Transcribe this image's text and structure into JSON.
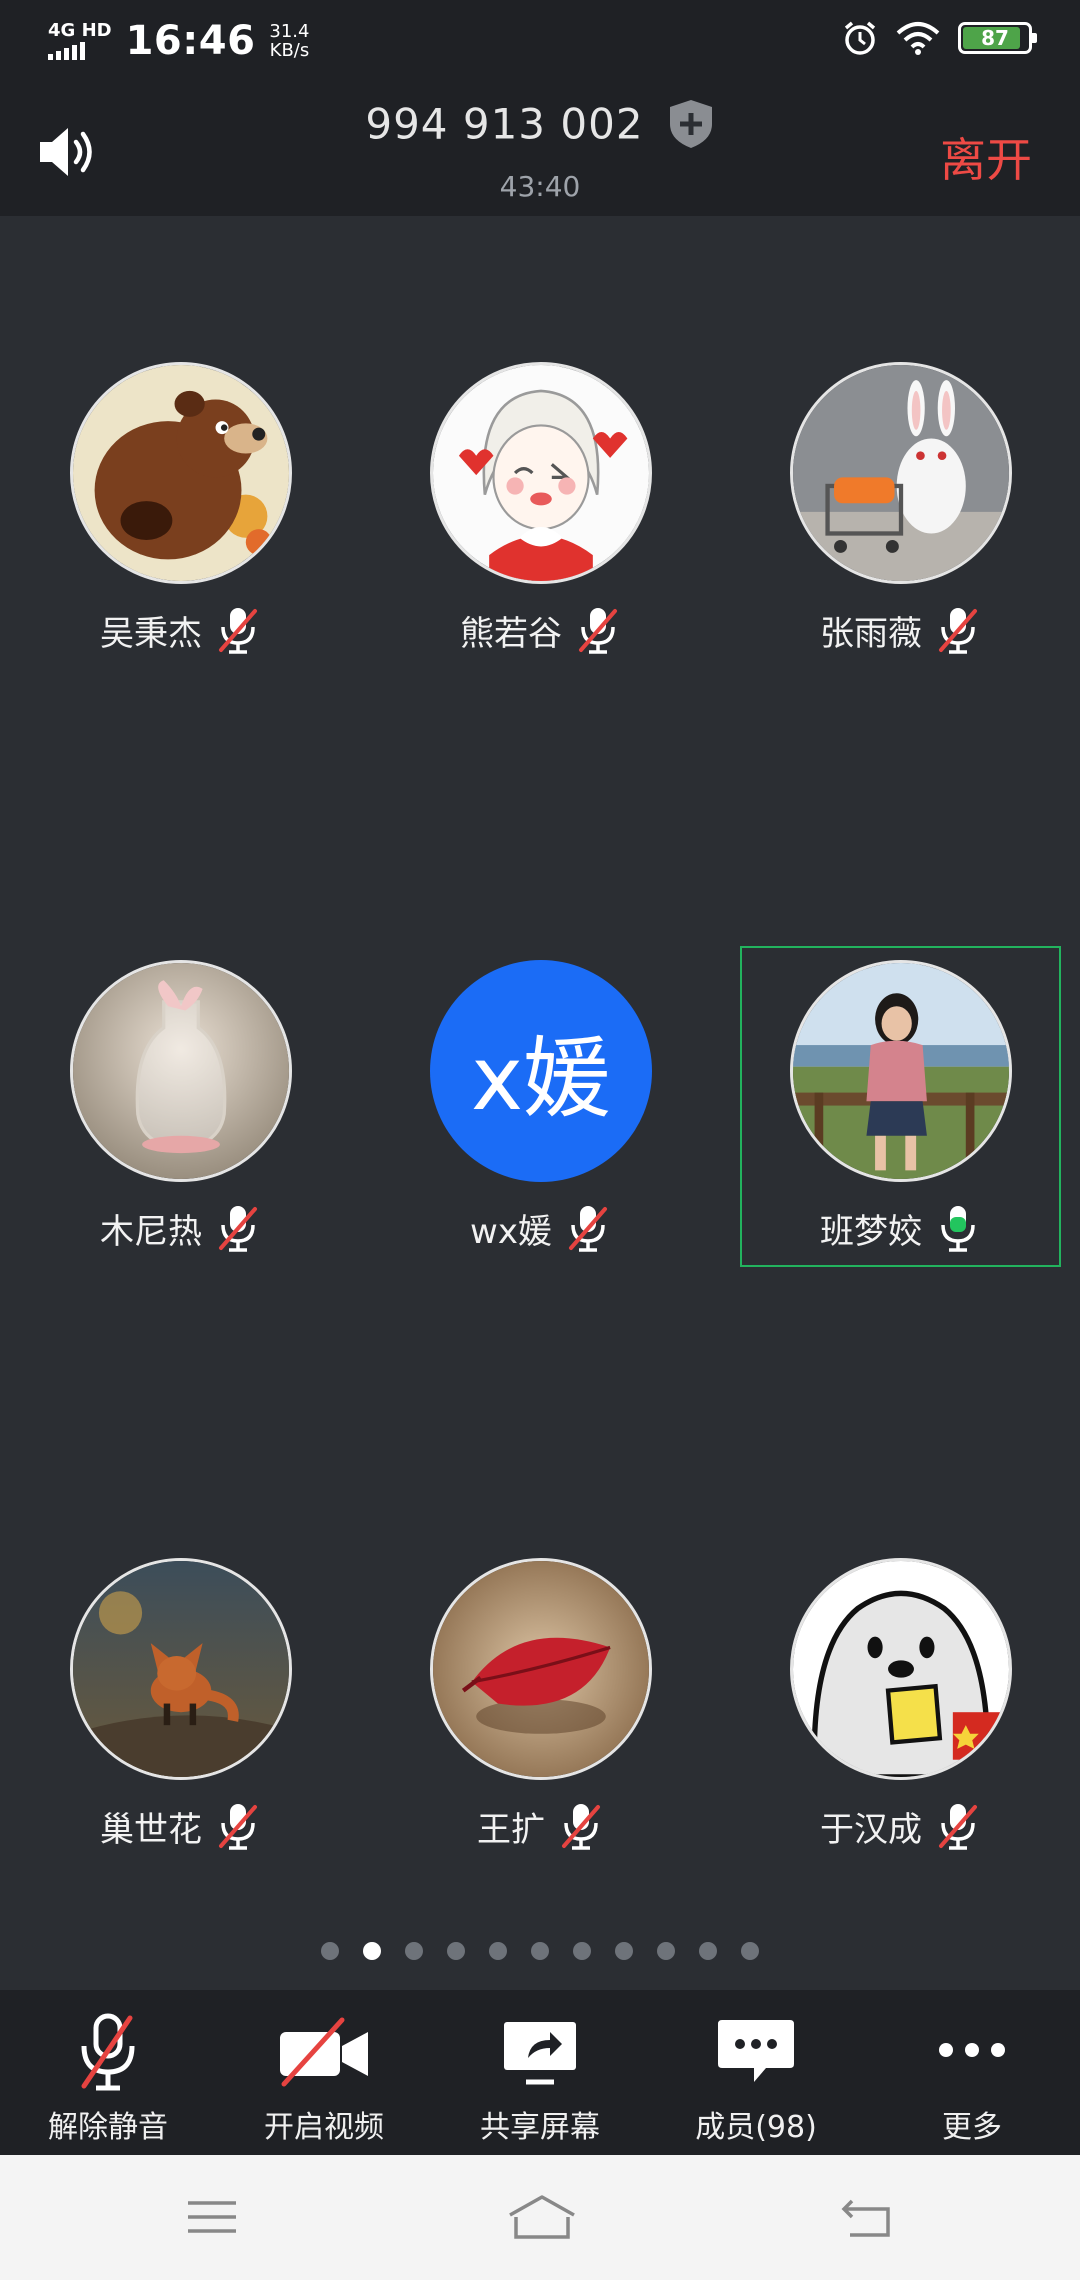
{
  "status_bar": {
    "network": "4G HD",
    "time": "16:46",
    "speed_value": "31.4",
    "speed_unit": "KB/s",
    "battery": "87"
  },
  "header": {
    "meeting_id": "994 913 002",
    "duration": "43:40",
    "leave_label": "离开"
  },
  "participants": [
    {
      "name": "吴秉杰",
      "avatar_icon": "bear-avatar-icon",
      "muted": true
    },
    {
      "name": "熊若谷",
      "avatar_icon": "girl-cartoon-avatar-icon",
      "muted": true
    },
    {
      "name": "张雨薇",
      "avatar_icon": "rabbit-avatar-icon",
      "muted": true
    },
    {
      "name": "木尼热",
      "avatar_icon": "bottle-avatar-icon",
      "muted": true
    },
    {
      "name": "wx媛",
      "avatar_text": "x媛",
      "muted": true
    },
    {
      "name": "班梦姣",
      "avatar_icon": "photo-avatar-icon",
      "muted": false,
      "speaking": true
    },
    {
      "name": "巢世花",
      "avatar_icon": "fox-avatar-icon",
      "muted": true
    },
    {
      "name": "王扩",
      "avatar_icon": "leaf-avatar-icon",
      "muted": true
    },
    {
      "name": "于汉成",
      "avatar_icon": "duck-meme-avatar-icon",
      "muted": true
    }
  ],
  "pager": {
    "total": 11,
    "current": 2
  },
  "toolbar": {
    "unmute": "解除静音",
    "start_video": "开启视频",
    "share_screen": "共享屏幕",
    "members": "成员(98)",
    "more": "更多"
  },
  "colors": {
    "background": "#2b2e33",
    "bar": "#1f2125",
    "leave": "#ee4a45",
    "muted_slash": "#e64340",
    "speaking": "#22b35e",
    "text_avatar": "#1b6cf6"
  }
}
